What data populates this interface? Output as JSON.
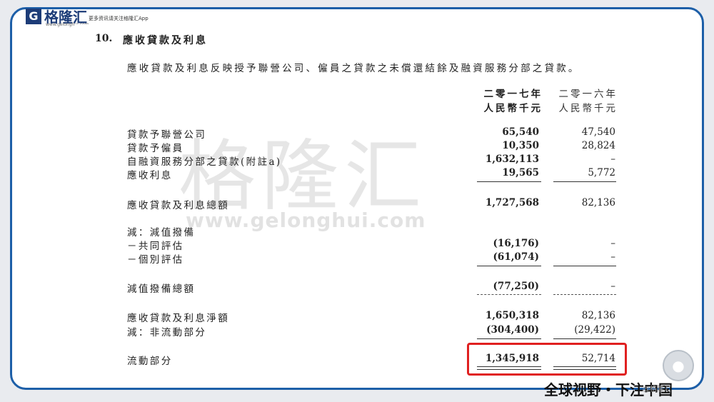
{
  "brand": {
    "logo_letter": "G",
    "name": "格隆汇",
    "url": "www.gelonghui.com",
    "tagline": "更多资讯请关注格隆汇App",
    "watermark": "格隆汇",
    "watermark_url": "www.gelonghui.com",
    "banner": "全球视野・下注中国",
    "small_watermark": "@格隆汇"
  },
  "section": {
    "number": "10.",
    "title": "應收貸款及利息",
    "intro": "應收貸款及利息反映授予聯營公司、僱員之貸款之未償還結餘及融資服務分部之貸款。"
  },
  "columns": {
    "y2017_year": "二零一七年",
    "y2017_unit": "人民幣千元",
    "y2016_year": "二零一六年",
    "y2016_unit": "人民幣千元"
  },
  "rows": [
    {
      "label": "貸款予聯營公司",
      "v2017": "65,540",
      "v2016": "47,540"
    },
    {
      "label": "貸款予僱員",
      "v2017": "10,350",
      "v2016": "28,824"
    },
    {
      "label": "自融資服務分部之貸款(附註a)",
      "v2017": "1,632,113",
      "v2016": "–"
    },
    {
      "label": "應收利息",
      "v2017": "19,565",
      "v2016": "5,772"
    },
    {
      "label": "應收貸款及利息總額",
      "v2017": "1,727,568",
      "v2016": "82,136"
    },
    {
      "label": "減：減值撥備",
      "v2017": "",
      "v2016": ""
    },
    {
      "label": "－共同評估",
      "v2017": "(16,176)",
      "v2016": "–"
    },
    {
      "label": "－個別評估",
      "v2017": "(61,074)",
      "v2016": "–"
    },
    {
      "label": "減值撥備總額",
      "v2017": "(77,250)",
      "v2016": "–"
    },
    {
      "label": "應收貸款及利息淨額",
      "v2017": "1,650,318",
      "v2016": "82,136"
    },
    {
      "label": "減：非流動部分",
      "v2017": "(304,400)",
      "v2016": "(29,422)"
    },
    {
      "label": "流動部分",
      "v2017": "1,345,918",
      "v2016": "52,714"
    }
  ]
}
